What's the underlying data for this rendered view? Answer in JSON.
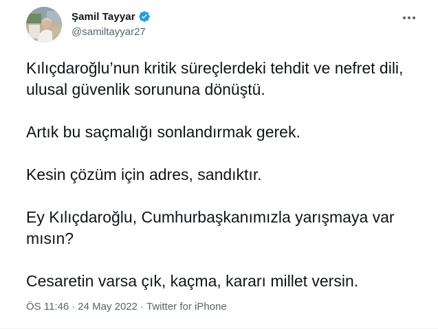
{
  "author": {
    "display_name": "Şamil Tayyar",
    "handle": "@samiltayyar27",
    "verified": true,
    "avatar_icon": "profile-photo",
    "verified_color": "#1d9bf0"
  },
  "menu_icon": "more-horizontal-icon",
  "tweet": {
    "paragraphs": [
      "Kılıçdaroğlu’nun kritik süreçlerdeki tehdit ve nefret dili, ulusal güvenlik sorununa dönüştü.",
      "Artık bu saçmalığı sonlandırmak gerek.",
      "Kesin çözüm için adres, sandıktır.",
      "Ey Kılıçdaroğlu, Cumhurbaşkanımızla yarışmaya var mısın?",
      "Cesaretin varsa çık, kaçma, kararı millet versin."
    ]
  },
  "meta": {
    "time": "ÖS 11:46",
    "separator": "·",
    "date": "24 May 2022",
    "source": "Twitter for iPhone"
  }
}
